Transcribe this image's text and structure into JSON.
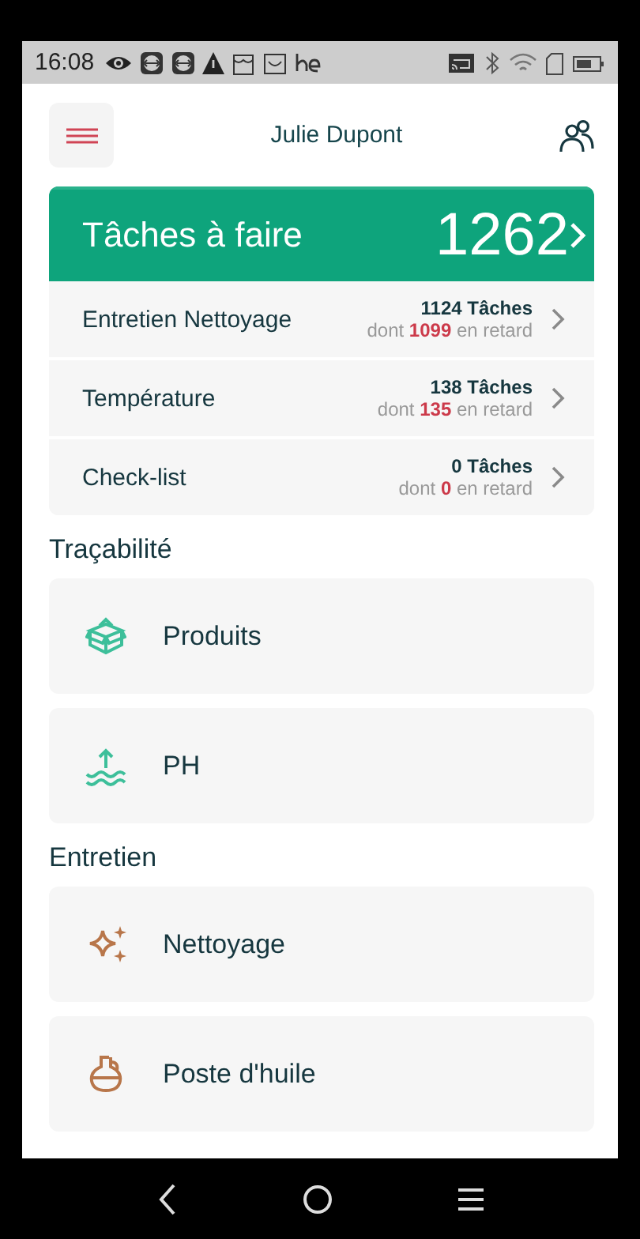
{
  "status_bar": {
    "time": "16:08"
  },
  "header": {
    "user": "Julie Dupont"
  },
  "tasks": {
    "title": "Tâches à faire",
    "total": "1262",
    "rows": [
      {
        "label": "Entretien Nettoyage",
        "count": "1124 Tâches",
        "late_prefix": "dont",
        "late": "1099",
        "late_suffix": "en retard"
      },
      {
        "label": "Température",
        "count": "138 Tâches",
        "late_prefix": "dont",
        "late": "135",
        "late_suffix": "en retard"
      },
      {
        "label": "Check-list",
        "count": "0 Tâches",
        "late_prefix": "dont",
        "late": "0",
        "late_suffix": "en retard"
      }
    ]
  },
  "sections": [
    {
      "title": "Traçabilité",
      "items": [
        {
          "label": "Produits",
          "kind": "box",
          "color": "#3dbf9a"
        },
        {
          "label": "PH",
          "kind": "ph",
          "color": "#3dbf9a"
        }
      ]
    },
    {
      "title": "Entretien",
      "items": [
        {
          "label": "Nettoyage",
          "kind": "sparkle",
          "color": "#b8764a"
        },
        {
          "label": "Poste d'huile",
          "kind": "flask",
          "color": "#b8764a"
        }
      ]
    }
  ]
}
